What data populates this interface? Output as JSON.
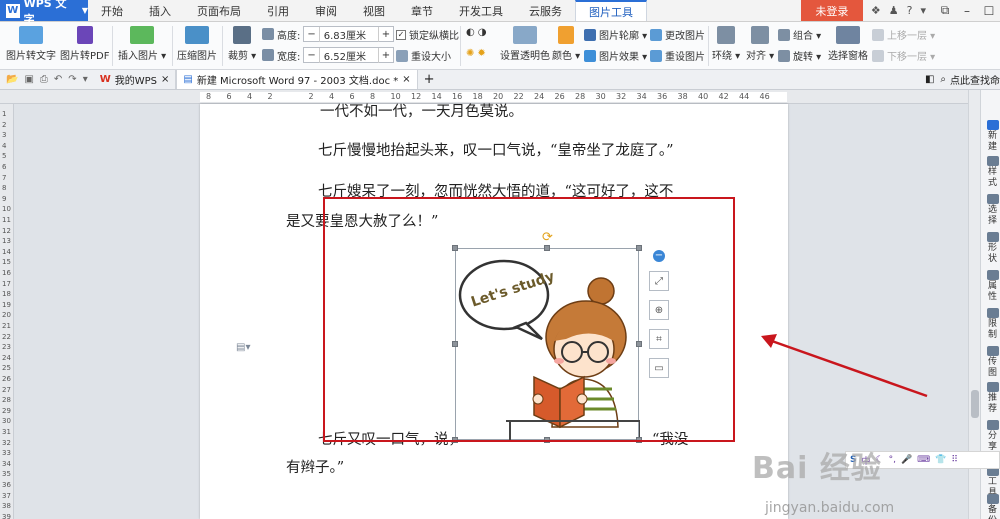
{
  "menubar": {
    "app_label": "WPS 文字",
    "tabs": [
      "开始",
      "插入",
      "页面布局",
      "引用",
      "审阅",
      "视图",
      "章节",
      "开发工具",
      "云服务",
      "图片工具"
    ],
    "active_tab": "图片工具",
    "login_label": "未登录"
  },
  "ribbon": {
    "pic_to_text": "图片转文字",
    "pic_to_pdf": "图片转PDF",
    "insert_pic": "插入图片 ▾",
    "compress_pic": "压缩图片",
    "crop": "裁剪 ▾",
    "height_label": "高度:",
    "height_value": "6.83厘米",
    "width_label": "宽度:",
    "width_value": "6.52厘米",
    "lock_ratio": "锁定纵横比",
    "reset_size": "重设大小",
    "set_transparent": "设置透明色",
    "color": "颜色 ▾",
    "pic_outline": "图片轮廓 ▾",
    "pic_effect": "图片效果 ▾",
    "change_pic": "更改图片",
    "reset_pic": "重设图片",
    "wrap": "环绕 ▾",
    "align": "对齐 ▾",
    "group": "组合 ▾",
    "rotate": "旋转 ▾",
    "select_pane": "选择窗格",
    "bring_forward": "上移一层 ▾",
    "send_backward": "下移一层 ▾"
  },
  "tabstrip": {
    "tab1": "我的WPS",
    "tab2": "新建 Microsoft Word 97 - 2003 文档.doc *",
    "add": "+",
    "right_text": "点此查找命"
  },
  "ruler": {
    "h_numbers": [
      "8",
      "6",
      "4",
      "2",
      "",
      "2",
      "4",
      "6",
      "8",
      "10",
      "12",
      "14",
      "16",
      "18",
      "20",
      "22",
      "24",
      "26",
      "28",
      "30",
      "32",
      "34",
      "36",
      "38",
      "40",
      "42",
      "44",
      "46"
    ],
    "v_numbers": [
      "1",
      "2",
      "3",
      "4",
      "5",
      "6",
      "7",
      "8",
      "9",
      "10",
      "11",
      "12",
      "13",
      "14",
      "15",
      "16",
      "17",
      "18",
      "19",
      "20",
      "21",
      "22",
      "23",
      "24",
      "25",
      "26",
      "27",
      "28",
      "29",
      "30",
      "31",
      "32",
      "33",
      "34",
      "35",
      "36",
      "37",
      "38",
      "39"
    ]
  },
  "document": {
    "line0": "一代不如一代，一天月色莫说。",
    "line1": "七斤慢慢地抬起头来，叹一口气说，“皇帝坐了龙庭了。”",
    "line2": "七斤嫂呆了一刻，忽而恍然大悟的道，“这可好了，这不",
    "line3": "是又要皇恩大赦了么！”",
    "line4a": "七斤又叹一口气，说，",
    "line4b": "“我没",
    "line5": "有辫子。”"
  },
  "image": {
    "speech_text": "Let's study"
  },
  "rpanel": {
    "items": [
      "新建",
      "样式",
      "选择",
      "形状",
      "属性",
      "限制",
      "传图",
      "推荐",
      "分享",
      "工具",
      "备份"
    ]
  },
  "ime": {
    "s_label": "S",
    "zh_label": "中"
  },
  "watermark": {
    "brand": "Bai 经验",
    "url": "jingyan.baidu.com"
  }
}
